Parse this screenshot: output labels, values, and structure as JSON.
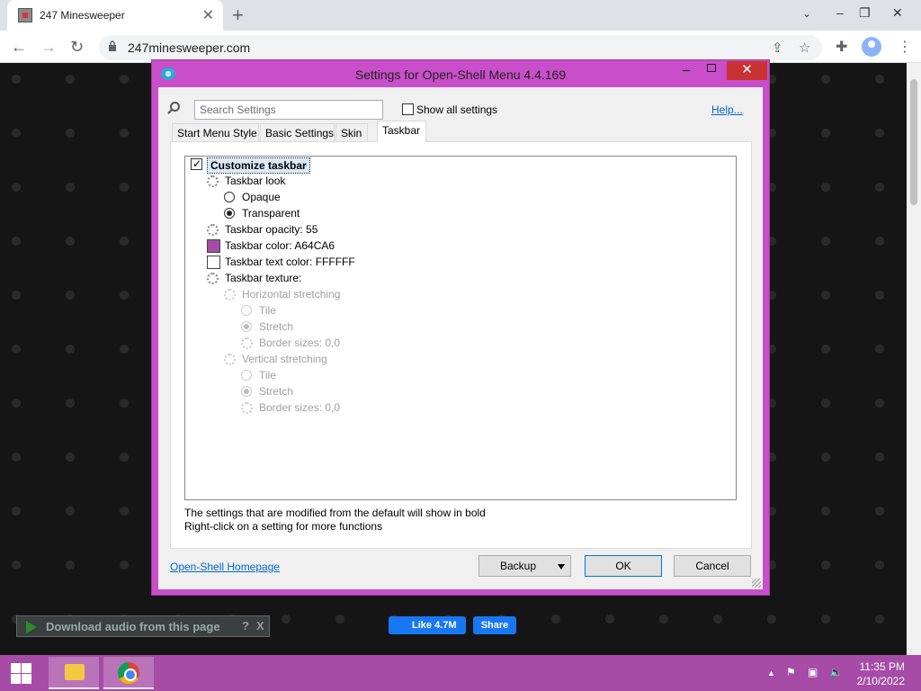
{
  "browser": {
    "tab_title": "247 Minesweeper",
    "url": "247minesweeper.com"
  },
  "page": {
    "download_label": "Download audio from this page",
    "download_help": "?",
    "download_close": "X",
    "fb_like": "Like 4.7M",
    "fb_share": "Share"
  },
  "dialog": {
    "title": "Settings for Open-Shell Menu 4.4.169",
    "search_placeholder": "Search Settings",
    "show_all_label": "Show all settings",
    "help_link": "Help...",
    "tabs": [
      {
        "label": "Start Menu Style"
      },
      {
        "label": "Basic Settings"
      },
      {
        "label": "Skin"
      },
      {
        "label": "Taskbar"
      }
    ],
    "active_tab": "Taskbar",
    "tree": [
      {
        "label": "Customize taskbar"
      },
      {
        "label": "Taskbar look"
      },
      {
        "label": "Opaque"
      },
      {
        "label": "Transparent"
      },
      {
        "label": "Taskbar opacity: 55"
      },
      {
        "label": "Taskbar color: A64CA6"
      },
      {
        "label": "Taskbar text color: FFFFFF"
      },
      {
        "label": "Taskbar texture:"
      },
      {
        "label": "Horizontal stretching"
      },
      {
        "label": "Tile"
      },
      {
        "label": "Stretch"
      },
      {
        "label": "Border sizes: 0,0"
      },
      {
        "label": "Vertical stretching"
      },
      {
        "label": "Tile"
      },
      {
        "label": "Stretch"
      },
      {
        "label": "Border sizes: 0,0"
      }
    ],
    "taskbar_color": "#A64CA6",
    "taskbar_text_color": "#FFFFFF",
    "note_line1": "The settings that are modified from the default will show in bold",
    "note_line2": "Right-click on a setting for more functions",
    "homepage_link": "Open-Shell Homepage",
    "buttons": {
      "backup": "Backup",
      "ok": "OK",
      "cancel": "Cancel"
    }
  },
  "taskbar": {
    "time": "11:35 PM",
    "date": "2/10/2022",
    "accent": "#A64CA6"
  }
}
